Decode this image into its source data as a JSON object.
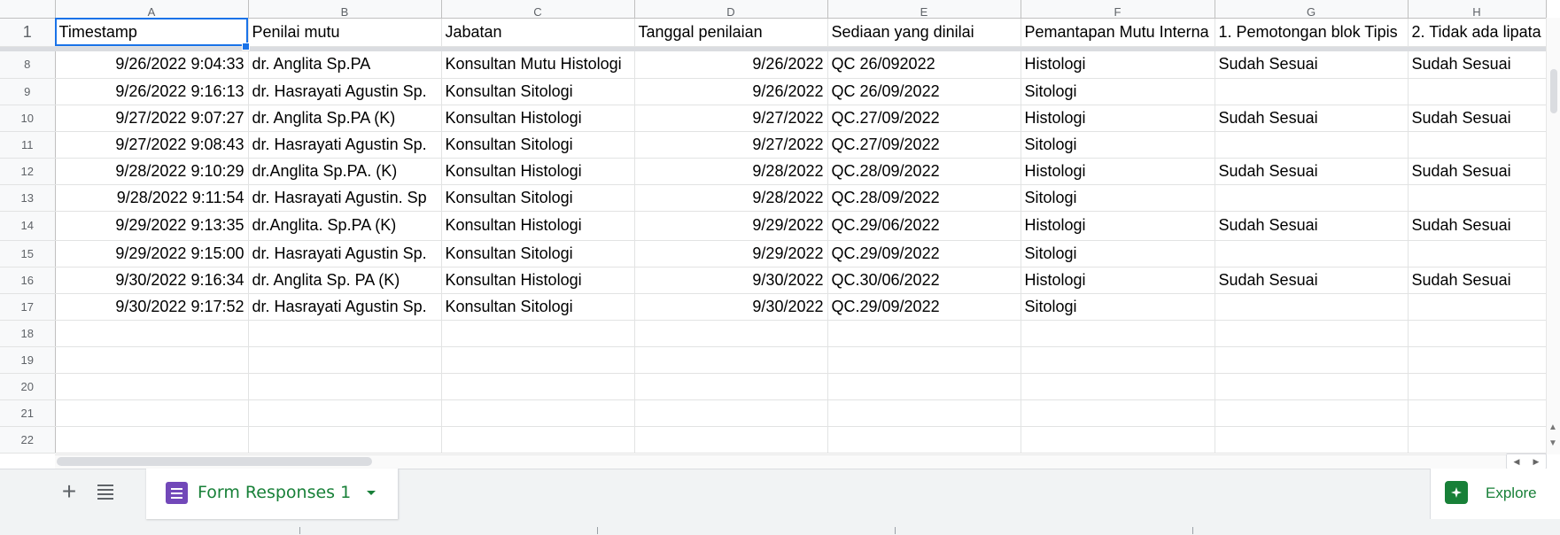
{
  "sheet": {
    "column_letters": [
      "A",
      "B",
      "C",
      "D",
      "E",
      "F",
      "G",
      "H"
    ],
    "header_row_number": "1",
    "headers": [
      "Timestamp",
      "Penilai mutu",
      "Jabatan",
      "Tanggal penilaian",
      "Sediaan yang dinilai",
      "Pemantapan Mutu Interna",
      "1. Pemotongan blok Tipis",
      "2. Tidak ada lipata"
    ],
    "rows": [
      {
        "num": "8",
        "cells": [
          "9/26/2022 9:04:33",
          "dr. Anglita Sp.PA",
          "Konsultan Mutu Histologi",
          "9/26/2022",
          "QC 26/092022",
          "Histologi",
          "Sudah Sesuai",
          "Sudah Sesuai"
        ]
      },
      {
        "num": "9",
        "cells": [
          "9/26/2022 9:16:13",
          "dr. Hasrayati Agustin Sp.",
          "Konsultan Sitologi",
          "9/26/2022",
          "QC 26/09/2022",
          "Sitologi",
          "",
          ""
        ]
      },
      {
        "num": "10",
        "cells": [
          "9/27/2022 9:07:27",
          "dr. Anglita Sp.PA (K)",
          "Konsultan Histologi",
          "9/27/2022",
          "QC.27/09/2022",
          "Histologi",
          "Sudah Sesuai",
          "Sudah Sesuai"
        ]
      },
      {
        "num": "11",
        "cells": [
          "9/27/2022 9:08:43",
          "dr. Hasrayati Agustin Sp.",
          "Konsultan Sitologi",
          "9/27/2022",
          "QC.27/09/2022",
          "Sitologi",
          "",
          ""
        ]
      },
      {
        "num": "12",
        "cells": [
          "9/28/2022 9:10:29",
          "dr.Anglita Sp.PA. (K)",
          "Konsultan Histologi",
          "9/28/2022",
          "QC.28/09/2022",
          "Histologi",
          "Sudah Sesuai",
          "Sudah Sesuai"
        ]
      },
      {
        "num": "13",
        "cells": [
          "9/28/2022 9:11:54",
          "dr. Hasrayati Agustin. Sp",
          "Konsultan Sitologi",
          "9/28/2022",
          "QC.28/09/2022",
          "Sitologi",
          "",
          ""
        ]
      },
      {
        "num": "14",
        "cells": [
          "9/29/2022 9:13:35",
          "dr.Anglita. Sp.PA (K)",
          "Konsultan Histologi",
          "9/29/2022",
          "QC.29/06/2022",
          "Histologi",
          "Sudah Sesuai",
          "Sudah Sesuai"
        ]
      },
      {
        "num": "15",
        "cells": [
          "9/29/2022 9:15:00",
          "dr. Hasrayati Agustin Sp.",
          "Konsultan Sitologi",
          "9/29/2022",
          "QC.29/09/2022",
          "Sitologi",
          "",
          ""
        ]
      },
      {
        "num": "16",
        "cells": [
          "9/30/2022 9:16:34",
          "dr. Anglita Sp. PA (K)",
          "Konsultan Histologi",
          "9/30/2022",
          "QC.30/06/2022",
          "Histologi",
          "Sudah Sesuai",
          "Sudah Sesuai"
        ]
      },
      {
        "num": "17",
        "cells": [
          "9/30/2022 9:17:52",
          "dr. Hasrayati Agustin Sp.",
          "Konsultan Sitologi",
          "9/30/2022",
          "QC.29/09/2022",
          "Sitologi",
          "",
          ""
        ]
      }
    ],
    "empty_rows": [
      "18",
      "19",
      "20",
      "21",
      "22"
    ]
  },
  "tabs": {
    "add_icon": "plus-icon",
    "list_icon": "all-sheets-icon",
    "active_label": "Form Responses 1",
    "active_icon": "form-icon"
  },
  "explore": {
    "label": "Explore",
    "icon": "explore-icon"
  },
  "colors": {
    "selection": "#1a73e8",
    "tab_text": "#188038",
    "form_icon": "#7248b9"
  }
}
